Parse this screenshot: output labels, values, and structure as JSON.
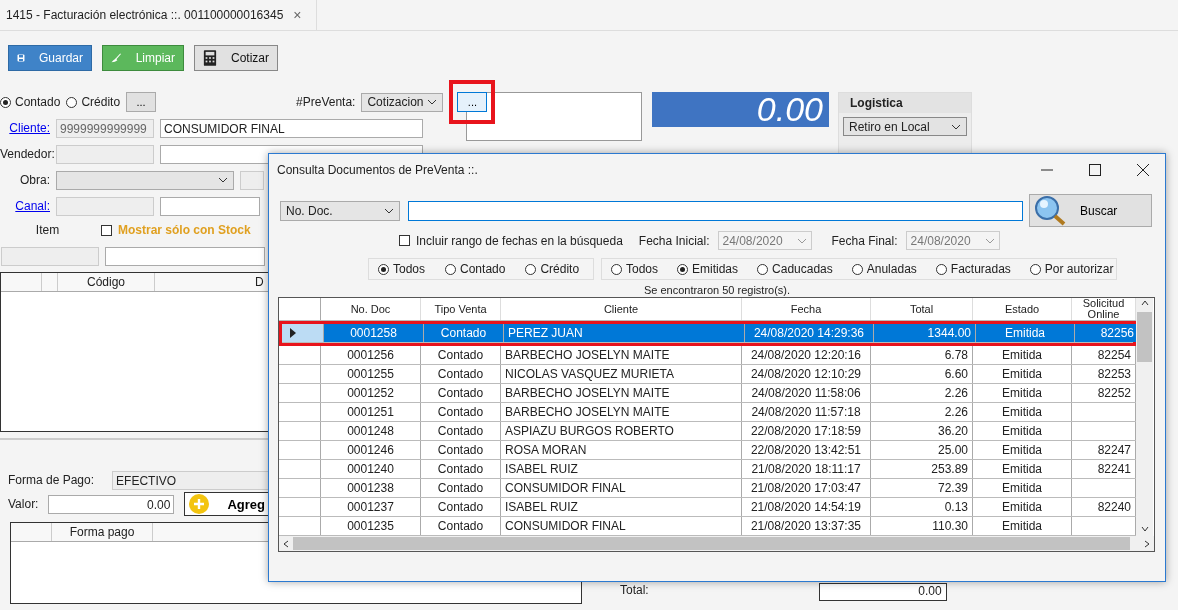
{
  "tab": {
    "title": "1415 - Facturación electrónica ::. 001100000016345",
    "close": "×"
  },
  "toolbar": [
    {
      "kind": "save",
      "label": "Guardar"
    },
    {
      "kind": "clean",
      "label": "Limpiar"
    },
    {
      "kind": "quote",
      "label": "Cotizar"
    }
  ],
  "payment_type": [
    {
      "label": "Contado",
      "selected": true
    },
    {
      "label": "Crédito",
      "selected": false
    }
  ],
  "payment_more": "...",
  "preventa": {
    "label": "#PreVenta:",
    "value": "Cotizacion",
    "button": "...",
    "highlighted": true
  },
  "total_display": "0.00",
  "logistica": {
    "title": "Logistica",
    "value": "Retiro en Local"
  },
  "form": {
    "cliente_label": "Cliente:",
    "cliente_id": "9999999999999",
    "cliente_name": "CONSUMIDOR FINAL",
    "vendedor_label": "Vendedor:",
    "obra_label": "Obra:",
    "canal_label": "Canal:",
    "item_label": "Item",
    "stock": {
      "label": "Mostrar sólo con Stock",
      "checked": false
    }
  },
  "items_table": {
    "columns": [
      "Código",
      "D"
    ]
  },
  "payment": {
    "label": "Forma de Pago:",
    "value": "EFECTIVO",
    "valor_label": "Valor:",
    "valor": "0.00",
    "add": "Agreg",
    "columns": [
      "Forma pago"
    ]
  },
  "total": {
    "label": "Total:",
    "value": "0.00"
  },
  "dialog": {
    "title": "Consulta Documentos de PreVenta ::.",
    "search_field": "No. Doc.",
    "search_button": "Buscar",
    "date_range": {
      "label": "Incluir rango de fechas en la búsqueda",
      "checked": false
    },
    "fecha_inicial_label": "Fecha Inicial:",
    "fecha_inicial": "24/08/2020",
    "fecha_final_label": "Fecha Final:",
    "fecha_final": "24/08/2020",
    "type_filter": [
      {
        "label": "Todos",
        "selected": true
      },
      {
        "label": "Contado",
        "selected": false
      },
      {
        "label": "Crédito",
        "selected": false
      }
    ],
    "status_filter": [
      {
        "label": "Todos",
        "selected": false
      },
      {
        "label": "Emitidas",
        "selected": true
      },
      {
        "label": "Caducadas",
        "selected": false
      },
      {
        "label": "Anuladas",
        "selected": false
      },
      {
        "label": "Facturadas",
        "selected": false
      },
      {
        "label": "Por autorizar",
        "selected": false
      }
    ],
    "count": "Se encontraron 50 registro(s).",
    "columns": [
      "No. Doc",
      "Tipo Venta",
      "Cliente",
      "Fecha",
      "Total",
      "Estado",
      "Solicitud Online"
    ],
    "rows": [
      {
        "cells": [
          "0001258",
          "Contado",
          "PEREZ JUAN",
          "24/08/2020 14:29:36",
          "1344.00",
          "Emitida",
          "82256"
        ],
        "selected": true,
        "highlighted": true
      },
      {
        "cells": [
          "0001256",
          "Contado",
          "BARBECHO JOSELYN MAITE",
          "24/08/2020 12:20:16",
          "6.78",
          "Emitida",
          "82254"
        ],
        "selected": false,
        "highlighted": false
      },
      {
        "cells": [
          "0001255",
          "Contado",
          "NICOLAS VASQUEZ MURIETA",
          "24/08/2020 12:10:29",
          "6.60",
          "Emitida",
          "82253"
        ],
        "selected": false,
        "highlighted": false
      },
      {
        "cells": [
          "0001252",
          "Contado",
          "BARBECHO JOSELYN MAITE",
          "24/08/2020 11:58:06",
          "2.26",
          "Emitida",
          "82252"
        ],
        "selected": false,
        "highlighted": false
      },
      {
        "cells": [
          "0001251",
          "Contado",
          "BARBECHO JOSELYN MAITE",
          "24/08/2020 11:57:18",
          "2.26",
          "Emitida",
          ""
        ],
        "selected": false,
        "highlighted": false
      },
      {
        "cells": [
          "0001248",
          "Contado",
          "ASPIAZU BURGOS ROBERTO",
          "22/08/2020 17:18:59",
          "36.20",
          "Emitida",
          ""
        ],
        "selected": false,
        "highlighted": false
      },
      {
        "cells": [
          "0001246",
          "Contado",
          "ROSA MORAN",
          "22/08/2020 13:42:51",
          "25.00",
          "Emitida",
          "82247"
        ],
        "selected": false,
        "highlighted": false
      },
      {
        "cells": [
          "0001240",
          "Contado",
          "ISABEL RUIZ",
          "21/08/2020 18:11:17",
          "253.89",
          "Emitida",
          "82241"
        ],
        "selected": false,
        "highlighted": false
      },
      {
        "cells": [
          "0001238",
          "Contado",
          "CONSUMIDOR FINAL",
          "21/08/2020 17:03:47",
          "72.39",
          "Emitida",
          ""
        ],
        "selected": false,
        "highlighted": false
      },
      {
        "cells": [
          "0001237",
          "Contado",
          "ISABEL RUIZ",
          "21/08/2020 14:54:19",
          "0.13",
          "Emitida",
          "82240"
        ],
        "selected": false,
        "highlighted": false
      },
      {
        "cells": [
          "0001235",
          "Contado",
          "CONSUMIDOR FINAL",
          "21/08/2020 13:37:35",
          "110.30",
          "Emitida",
          ""
        ],
        "selected": false,
        "highlighted": false
      }
    ]
  }
}
